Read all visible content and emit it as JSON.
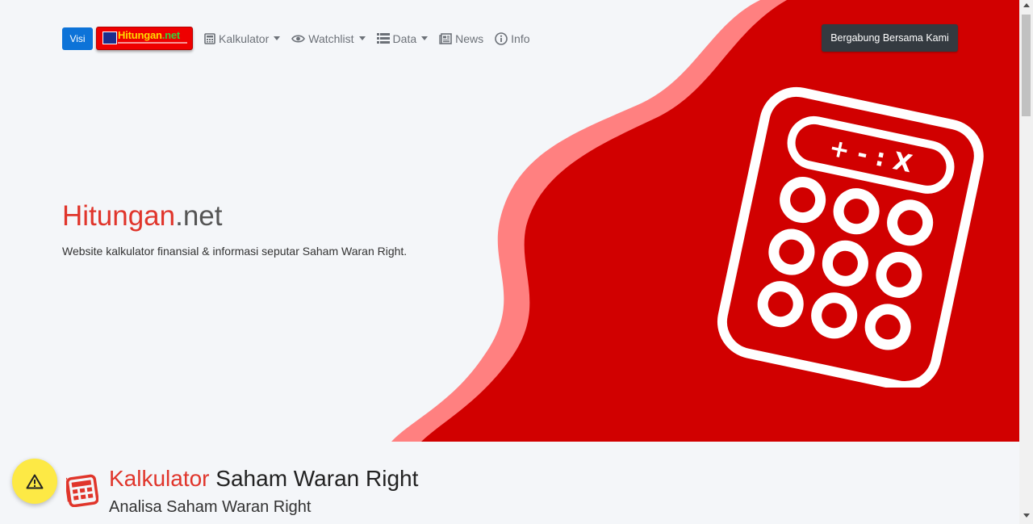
{
  "navbar": {
    "visi_label": "Visi",
    "logo_text_main": "Hitungan",
    "logo_text_suffix": ".net",
    "items": [
      {
        "label": "Kalkulator",
        "icon": "calculator-icon",
        "dropdown": true
      },
      {
        "label": "Watchlist",
        "icon": "eye-icon",
        "dropdown": true
      },
      {
        "label": "Data",
        "icon": "list-icon",
        "dropdown": true
      },
      {
        "label": "News",
        "icon": "newspaper-icon",
        "dropdown": false
      },
      {
        "label": "Info",
        "icon": "info-icon",
        "dropdown": false
      }
    ],
    "join_label": "Bergabung Bersama Kami"
  },
  "hero": {
    "title_red": "Hitungan",
    "title_rest": ".net",
    "subtitle": "Website kalkulator finansial & informasi seputar Saham Waran Right.",
    "calc_display": "+ - : X"
  },
  "section": {
    "title_red": "Kalkulator",
    "title_rest": " Saham Waran Right",
    "subtitle": "Analisa Saham Waran Right"
  },
  "colors": {
    "accent_red": "#d10000",
    "light_red": "#ff8080",
    "button_blue": "#0d73d8",
    "dark_button": "#343a40",
    "fab_yellow": "#fde945"
  }
}
